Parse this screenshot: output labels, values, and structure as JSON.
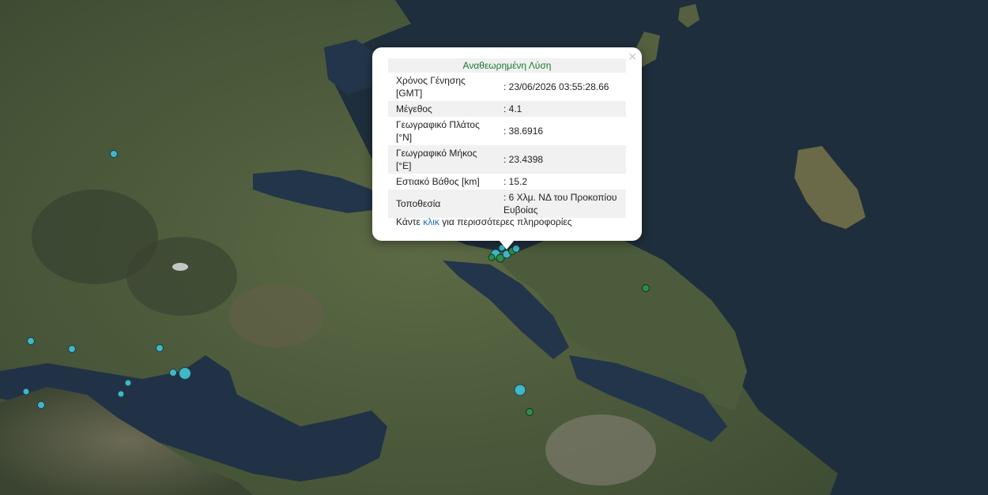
{
  "popup": {
    "title": "Αναθεωρημένη Λύση",
    "close_symbol": "×",
    "rows": [
      {
        "label": "Χρόνος Γένησης [GMT]",
        "value": ": 23/06/2026 03:55:28.66"
      },
      {
        "label": "Μέγεθος",
        "value": ": 4.1"
      },
      {
        "label": "Γεωγραφικό Πλάτος [°N]",
        "value": ": 38.6916"
      },
      {
        "label": "Γεωγραφικό Μήκος [°E]",
        "value": ": 23.4398"
      },
      {
        "label": "Εστιακό Βάθος [km]",
        "value": ": 15.2"
      },
      {
        "label": "Τοποθεσία",
        "value": ": 6 Χλμ. ΝΔ του Προκοπίου Ευβοίας"
      }
    ],
    "more_prefix": "Κάντε",
    "more_link": "κλικ",
    "more_suffix": "για περισσότερες πληροφορίες"
  },
  "map": {
    "basemap": "satellite",
    "colors": {
      "sea": "#1f2f3d",
      "land": "#4a5a3a",
      "marker_cyan": "#3fb8c8",
      "marker_green": "#2e8b4a"
    }
  }
}
